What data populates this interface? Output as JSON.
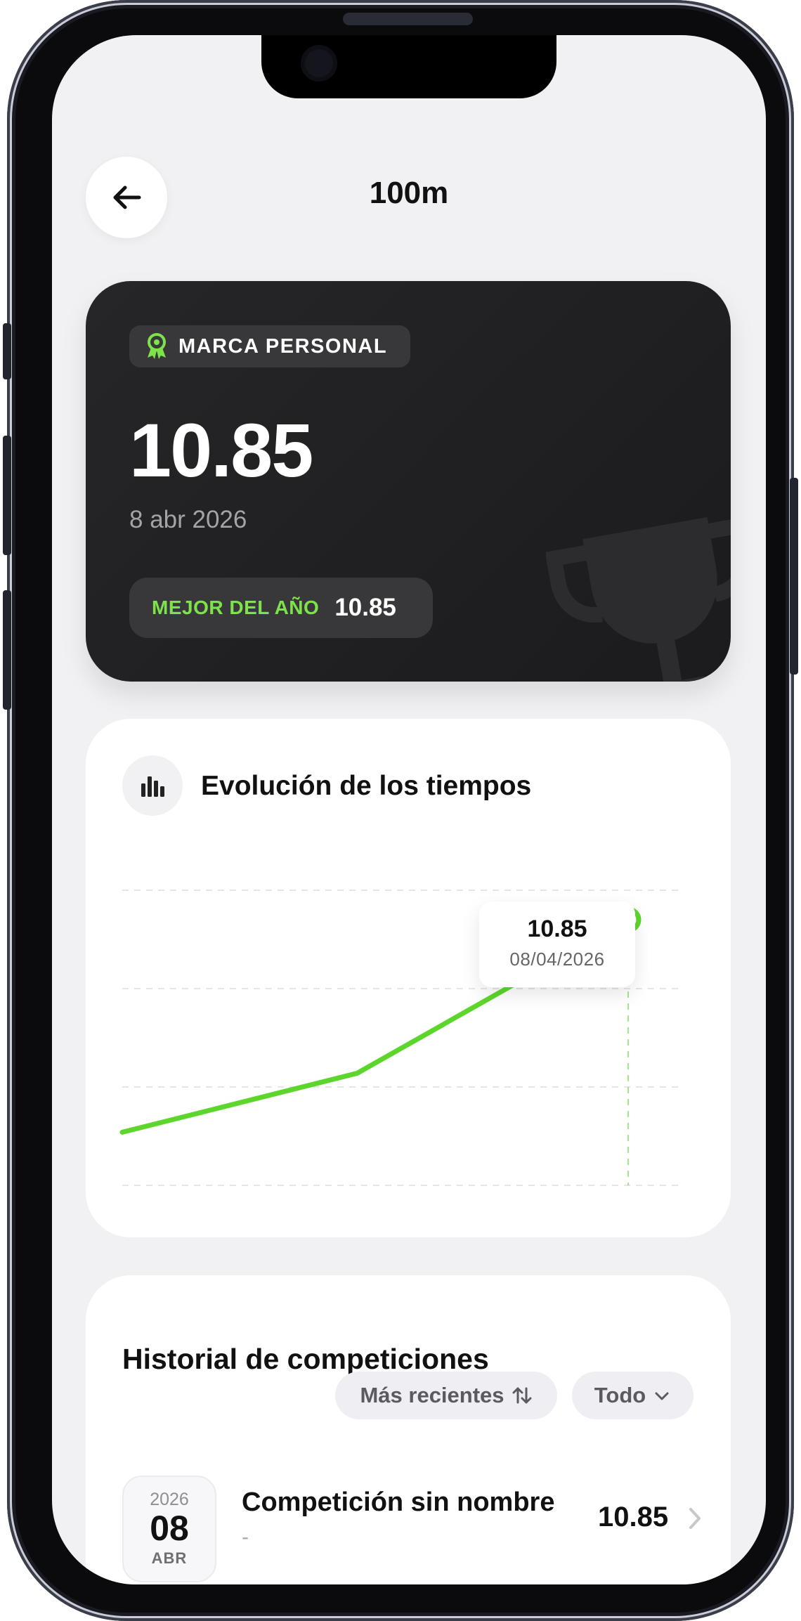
{
  "header": {
    "title": "100m"
  },
  "personal_best": {
    "badge_label": "MARCA PERSONAL",
    "value": "10.85",
    "date": "8 abr 2026",
    "year_best_label": "MEJOR DEL AÑO",
    "year_best_value": "10.85"
  },
  "chart": {
    "title": "Evolución de los tiempos",
    "tooltip_value": "10.85",
    "tooltip_date": "08/04/2026"
  },
  "chart_data": {
    "type": "line",
    "title": "Evolución de los tiempos",
    "x_index": [
      0,
      1,
      2
    ],
    "values_relative": [
      0.18,
      0.38,
      0.9
    ],
    "highlighted_point": {
      "value": 10.85,
      "date": "08/04/2026"
    },
    "grid": true,
    "line_color": "#5dd62c"
  },
  "history": {
    "title": "Historial de competiciones",
    "sort_label": "Más recientes",
    "filter_label": "Todo",
    "items": [
      {
        "year": "2026",
        "day": "08",
        "month": "ABR",
        "name": "Competición sin nombre",
        "subtitle": "-",
        "value": "10.85"
      }
    ]
  },
  "colors": {
    "accent": "#5dd62c",
    "accent_text": "#7ee24a",
    "card_dark": "#1f1f21",
    "background": "#f1f1f4"
  },
  "icons": [
    "arrow-left-icon",
    "medal-icon",
    "bar-chart-icon",
    "sort-arrows-icon",
    "chevron-down-icon",
    "chevron-right-icon",
    "trophy-icon"
  ]
}
